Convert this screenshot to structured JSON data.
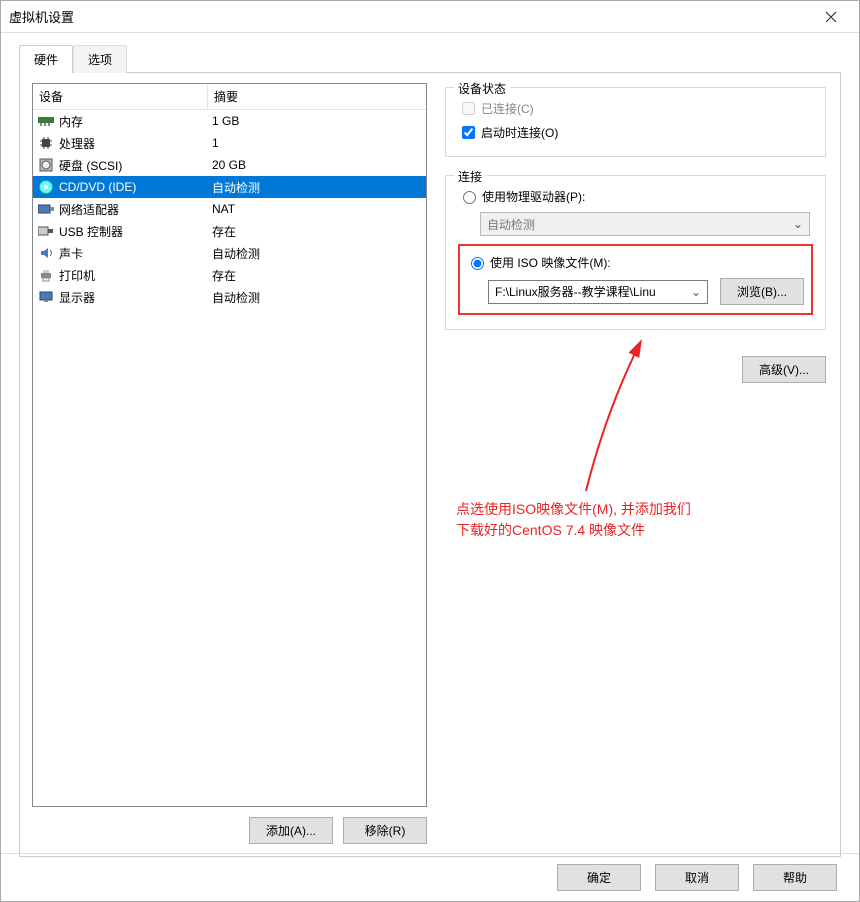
{
  "window": {
    "title": "虚拟机设置"
  },
  "tabs": {
    "hardware": "硬件",
    "options": "选项"
  },
  "deviceList": {
    "headers": {
      "device": "设备",
      "summary": "摘要"
    },
    "rows": [
      {
        "name": "内存",
        "summary": "1 GB",
        "icon": "memory-icon",
        "selected": false
      },
      {
        "name": "处理器",
        "summary": "1",
        "icon": "cpu-icon",
        "selected": false
      },
      {
        "name": "硬盘 (SCSI)",
        "summary": "20 GB",
        "icon": "disk-icon",
        "selected": false
      },
      {
        "name": "CD/DVD (IDE)",
        "summary": "自动检测",
        "icon": "cd-icon",
        "selected": true
      },
      {
        "name": "网络适配器",
        "summary": "NAT",
        "icon": "nic-icon",
        "selected": false
      },
      {
        "name": "USB 控制器",
        "summary": "存在",
        "icon": "usb-icon",
        "selected": false
      },
      {
        "name": "声卡",
        "summary": "自动检测",
        "icon": "sound-icon",
        "selected": false
      },
      {
        "name": "打印机",
        "summary": "存在",
        "icon": "printer-icon",
        "selected": false
      },
      {
        "name": "显示器",
        "summary": "自动检测",
        "icon": "display-icon",
        "selected": false
      }
    ]
  },
  "leftButtons": {
    "add": "添加(A)...",
    "remove": "移除(R)"
  },
  "status": {
    "legend": "设备状态",
    "connected": {
      "label": "已连接(C)",
      "checked": false,
      "disabled": true
    },
    "connectAtPower": {
      "label": "启动时连接(O)",
      "checked": true
    }
  },
  "connection": {
    "legend": "连接",
    "physical": {
      "label": "使用物理驱动器(P):",
      "selected": false,
      "dropdown": "自动检测"
    },
    "iso": {
      "label": "使用 ISO 映像文件(M):",
      "selected": true,
      "path": "F:\\Linux服务器--教学课程\\Linu",
      "browse": "浏览(B)..."
    },
    "advanced": "高级(V)..."
  },
  "annotation": {
    "line1": "点选使用ISO映像文件(M), 并添加我们",
    "line2": "下载好的CentOS 7.4 映像文件"
  },
  "footer": {
    "ok": "确定",
    "cancel": "取消",
    "help": "帮助"
  }
}
